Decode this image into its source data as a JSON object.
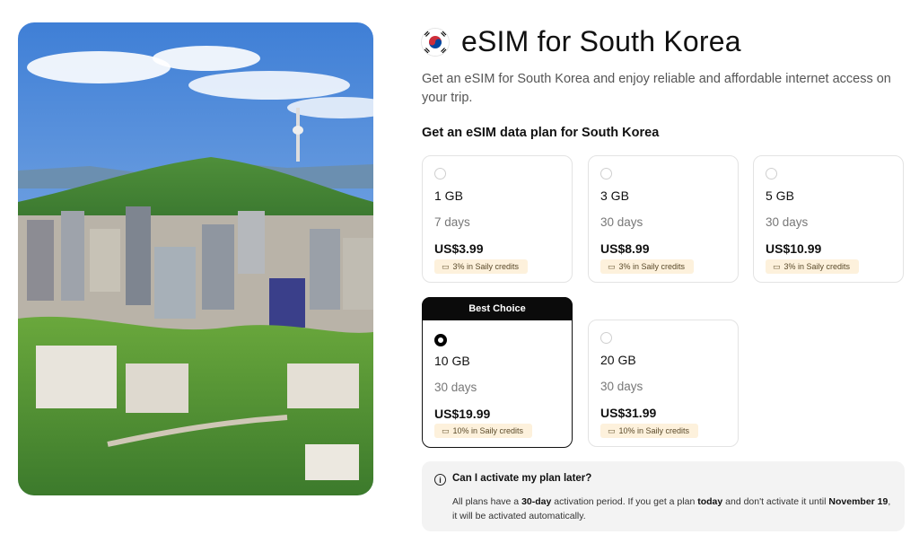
{
  "page": {
    "title": "eSIM for South Korea",
    "flag_icon": "south-korea-flag-icon",
    "intro": "Get an eSIM for South Korea and enjoy reliable and affordable internet access on your trip.",
    "plans_heading": "Get an eSIM data plan for South Korea"
  },
  "plans": [
    {
      "data": "1 GB",
      "validity": "7 days",
      "price": "US$3.99",
      "credits": "3% in Saily credits",
      "selected": false
    },
    {
      "data": "3 GB",
      "validity": "30 days",
      "price": "US$8.99",
      "credits": "3% in Saily credits",
      "selected": false
    },
    {
      "data": "5 GB",
      "validity": "30 days",
      "price": "US$10.99",
      "credits": "3% in Saily credits",
      "selected": false
    },
    {
      "data": "10 GB",
      "validity": "30 days",
      "price": "US$19.99",
      "credits": "10% in Saily credits",
      "selected": true,
      "badge": "Best Choice"
    },
    {
      "data": "20 GB",
      "validity": "30 days",
      "price": "US$31.99",
      "credits": "10% in Saily credits",
      "selected": false
    }
  ],
  "faq": {
    "question": "Can I activate my plan later?",
    "answer_parts": {
      "p1": "All plans have a ",
      "b1": "30-day",
      "p2": " activation period. If you get a plan ",
      "b2": "today",
      "p3": " and don't activate it until ",
      "b3": "November 19",
      "p4": ", it will be activated automatically."
    }
  },
  "colors": {
    "accent_black": "#0b0b0b",
    "credits_bg": "#fdf1dc",
    "faq_bg": "#f3f3f3"
  }
}
